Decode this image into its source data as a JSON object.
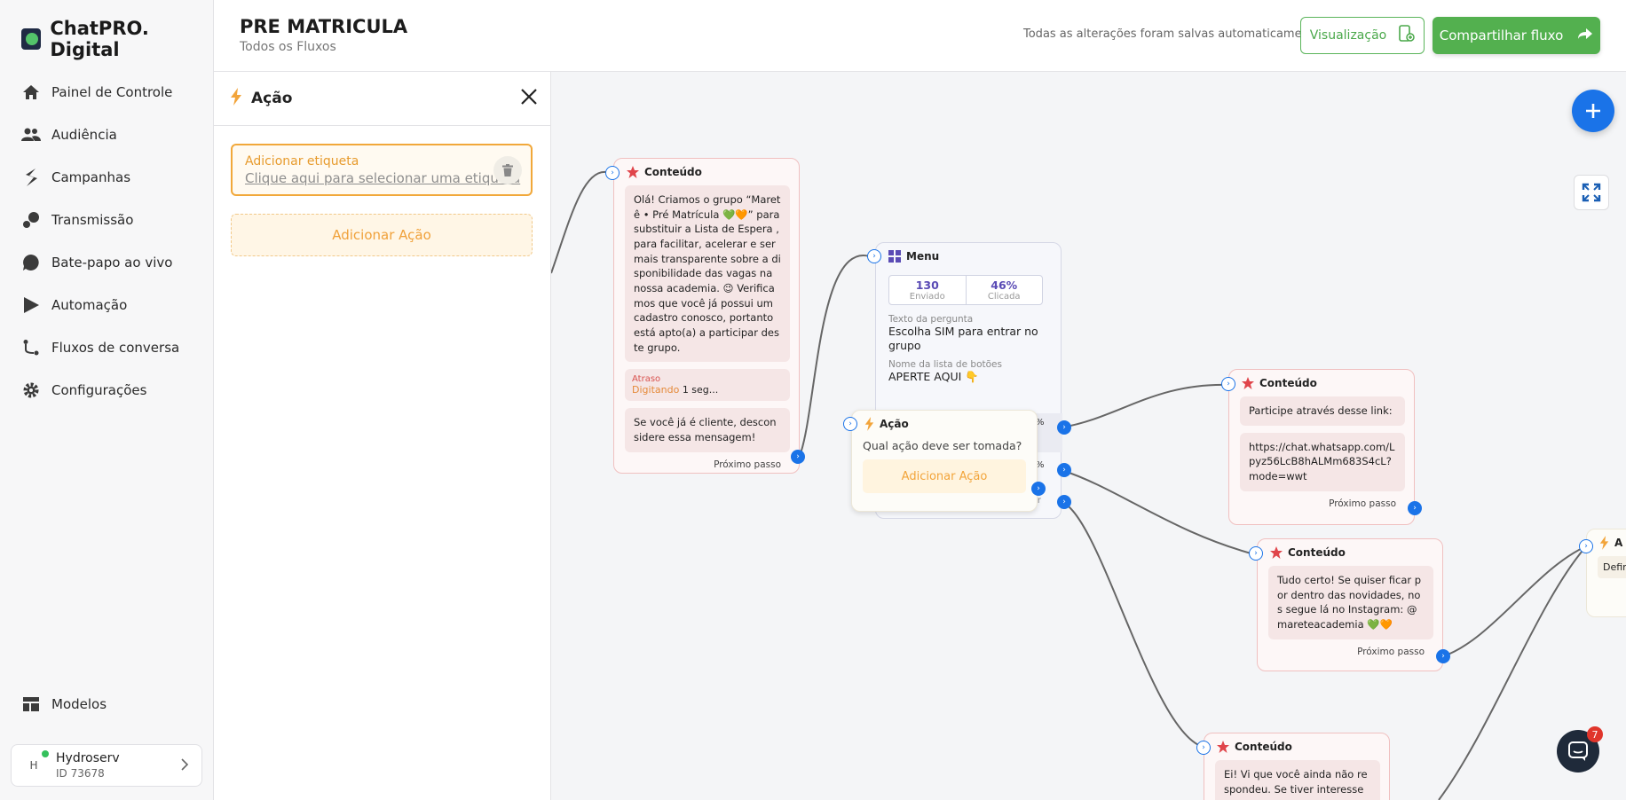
{
  "app": {
    "brand": "ChatPRO. Digital"
  },
  "sidebar": {
    "items": [
      {
        "label": "Painel de Controle",
        "icon": "home-icon"
      },
      {
        "label": "Audiência",
        "icon": "users-icon"
      },
      {
        "label": "Campanhas",
        "icon": "campaign-icon"
      },
      {
        "label": "Transmissão",
        "icon": "broadcast-icon"
      },
      {
        "label": "Bate-papo ao vivo",
        "icon": "chat-icon"
      },
      {
        "label": "Automação",
        "icon": "automation-icon"
      },
      {
        "label": "Fluxos de conversa",
        "icon": "flow-icon"
      },
      {
        "label": "Configurações",
        "icon": "gear-icon"
      }
    ],
    "bottom_item": {
      "label": "Modelos",
      "icon": "templates-icon"
    },
    "account": {
      "initial": "H",
      "name": "Hydroserv",
      "id": "ID 73678"
    }
  },
  "header": {
    "title": "PRE MATRICULA",
    "breadcrumb": "Todos os Fluxos",
    "autosave": "Todas as alterações foram salvas automaticamente",
    "view_label": "Visualização",
    "share_label": "Compartilhar fluxo"
  },
  "panel": {
    "title": "Ação",
    "tag_title": "Adicionar etiqueta",
    "tag_link": "Clique aqui para selecionar uma etiqueta",
    "add_action": "Adicionar Ação"
  },
  "canvas": {
    "chat_badge": "7",
    "node_content_1": {
      "title": "Conteúdo",
      "text": "Olá! Criamos o grupo “Maretê • Pré Matrícula 💚🧡” para substituir a Lista de Espera , para facilitar, acelerar e ser mais transparente sobre a disponibilidade das vagas na nossa academia. 😉 Verificamos que você já possui um cadastro conosco, portanto está apto(a) a participar deste grupo.",
      "delay_label": "Atraso",
      "delay_type": "Digitando",
      "delay_value": "1 seg...",
      "text2": "Se você já é cliente, desconsidere essa mensagem!",
      "next": "Próximo passo"
    },
    "node_menu": {
      "title": "Menu",
      "sent_value": "130",
      "sent_label": "Enviado",
      "clicked_value": "46%",
      "clicked_label": "Clicada",
      "question_label": "Texto da pergunta",
      "question": "Escolha SIM para entrar no grupo",
      "buttons_label": "Nome da lista de botões",
      "buttons_name": "APERTE AQUI 👇",
      "pct1": "%",
      "pct2": "%",
      "partial": "er"
    },
    "node_action": {
      "title": "Ação",
      "question": "Qual ação deve ser tomada?",
      "add": "Adicionar Ação"
    },
    "node_content_2": {
      "title": "Conteúdo",
      "text": "Participe através desse link:",
      "link": "https://chat.whatsapp.com/Lpyz56LcB8hALMm683S4cL?mode=wwt",
      "next": "Próximo passo"
    },
    "node_content_3": {
      "title": "Conteúdo",
      "text": "Tudo certo! Se quiser ficar por dentro das novidades, nos segue lá no Instagram: @mareteacademia  💚🧡",
      "next": "Próximo passo"
    },
    "node_content_4": {
      "title": "Conteúdo",
      "text": "Ei! Vi que você ainda não respondeu. Se tiver interesse em e"
    },
    "node_action_partial": {
      "title": "A",
      "text": "Defin"
    }
  },
  "colors": {
    "accent_blue": "#1a73e8",
    "brand_green": "#53b04f",
    "content_red": "#e0454b",
    "action_orange": "#f2a43a",
    "menu_purple": "#5a4bb5"
  }
}
